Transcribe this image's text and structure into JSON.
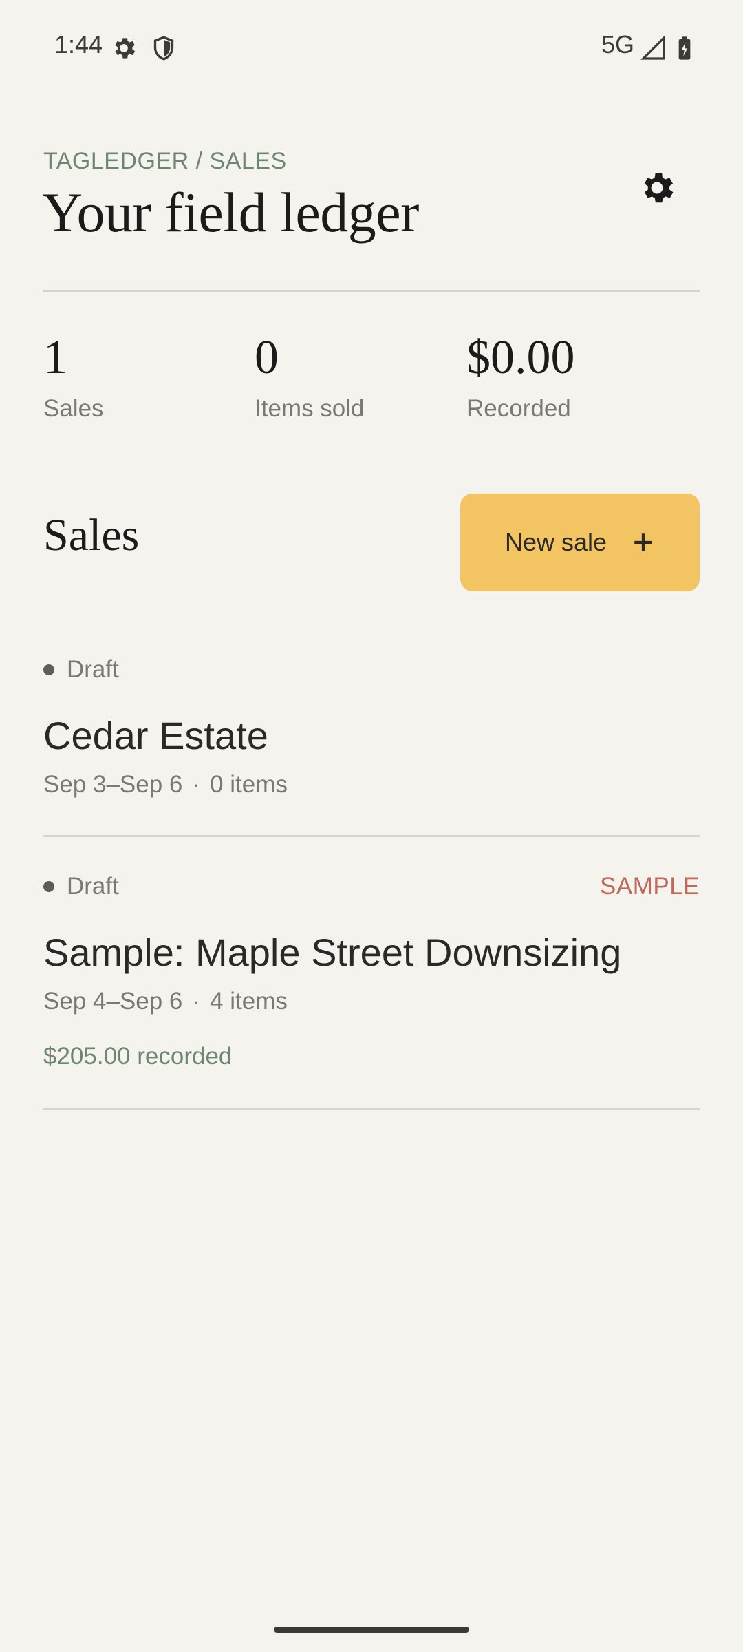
{
  "status_bar": {
    "time": "1:44",
    "network": "5G",
    "icons": [
      "gear-icon",
      "shield-icon",
      "signal-icon",
      "battery-charging-icon"
    ]
  },
  "header": {
    "breadcrumb": "TAGLEDGER / SALES",
    "title": "Your field ledger",
    "settings_icon": "gear-icon"
  },
  "stats": [
    {
      "value": "1",
      "label": "Sales"
    },
    {
      "value": "0",
      "label": "Items sold"
    },
    {
      "value": "$0.00",
      "label": "Recorded"
    }
  ],
  "sales_section": {
    "title": "Sales",
    "new_sale_label": "New sale",
    "new_sale_icon": "plus-icon"
  },
  "sales": [
    {
      "status": "Draft",
      "name": "Cedar Estate",
      "dates": "Sep 3–Sep 6",
      "items": "0 items",
      "separator": "·"
    },
    {
      "status": "Draft",
      "badge": "SAMPLE",
      "name": "Sample: Maple Street Downsizing",
      "dates": "Sep 4–Sep 6",
      "items": "4 items",
      "separator": "·",
      "recorded": "$205.00 recorded"
    }
  ],
  "colors": {
    "background": "#f5f3ee",
    "accent": "#f2c462",
    "muted_green": "#6d8672",
    "sample_red": "#c0685a"
  }
}
